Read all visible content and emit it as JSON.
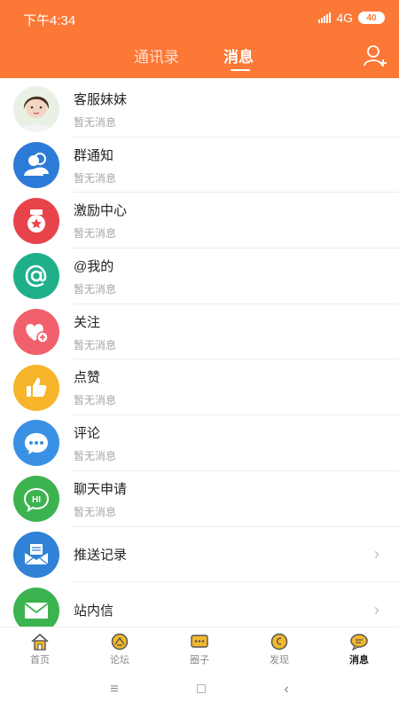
{
  "status": {
    "time": "下午4:34",
    "network": "4G",
    "battery": "40"
  },
  "header": {
    "tabs": [
      {
        "label": "通讯录",
        "active": false
      },
      {
        "label": "消息",
        "active": true
      }
    ],
    "accent": "#fb7836"
  },
  "messages": [
    {
      "title": "客服妹妹",
      "sub": "暂无消息",
      "icon": "customer-service-avatar"
    },
    {
      "title": "群通知",
      "sub": "暂无消息",
      "icon": "group-icon",
      "color": "#2d7bd8"
    },
    {
      "title": "激励中心",
      "sub": "暂无消息",
      "icon": "medal-icon",
      "color": "#e8434b"
    },
    {
      "title": "@我的",
      "sub": "暂无消息",
      "icon": "at-icon",
      "color": "#1fb08a"
    },
    {
      "title": "关注",
      "sub": "暂无消息",
      "icon": "heart-plus-icon",
      "color": "#f0606d"
    },
    {
      "title": "点赞",
      "sub": "暂无消息",
      "icon": "thumbs-up-icon",
      "color": "#f7b52c"
    },
    {
      "title": "评论",
      "sub": "暂无消息",
      "icon": "comment-icon",
      "color": "#3a90e5"
    },
    {
      "title": "聊天申请",
      "sub": "暂无消息",
      "icon": "hi-bubble-icon",
      "color": "#3db34f"
    },
    {
      "title": "推送记录",
      "icon": "push-record-icon",
      "color": "#2f82d5"
    },
    {
      "title": "站内信",
      "icon": "mail-icon",
      "color": "#3bb34e"
    }
  ],
  "hi_text": "HI",
  "tabbar": [
    {
      "label": "首页",
      "icon": "home-icon"
    },
    {
      "label": "论坛",
      "icon": "forum-icon"
    },
    {
      "label": "圈子",
      "icon": "circle-icon"
    },
    {
      "label": "发现",
      "icon": "discover-icon"
    },
    {
      "label": "消息",
      "icon": "message-icon",
      "active": true
    }
  ],
  "sysnav": {
    "menu": "≡",
    "home": "□",
    "back": "‹"
  }
}
